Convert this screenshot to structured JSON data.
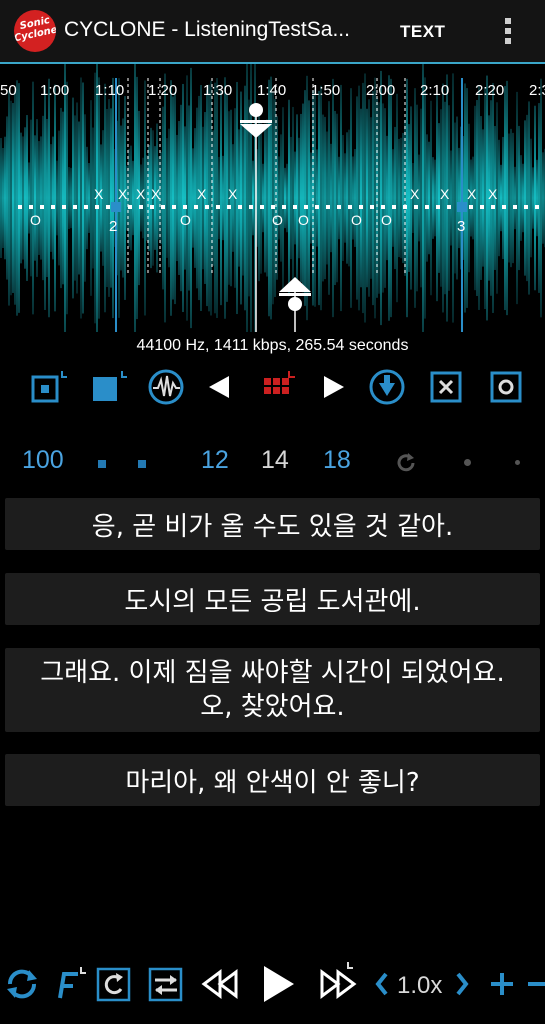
{
  "header": {
    "logo_line1": "Sonic",
    "logo_line2": "Cyclone",
    "title": "CYCLONE - ListeningTestSa...",
    "text_button": "TEXT",
    "overflow_icon": "more-vert-icon"
  },
  "timeline": {
    "ticks": [
      "50",
      "1:00",
      "1:10",
      "1:20",
      "1:30",
      "1:40",
      "1:50",
      "2:00",
      "2:10",
      "2:20",
      "2:3"
    ],
    "marker_numbers": [
      "2",
      "3"
    ]
  },
  "audio_info": "44100 Hz, 1411 kbps, 265.54 seconds",
  "controls": {
    "icons": [
      "loop-start-icon",
      "loop-end-icon",
      "waveform-icon",
      "prev-icon",
      "grid-icon",
      "next-icon",
      "download-icon",
      "clear-icon",
      "record-icon"
    ]
  },
  "marker_row": {
    "left_value": "100",
    "values": [
      "12",
      "14",
      "18"
    ]
  },
  "subtitles": [
    "응, 곧 비가 올 수도 있을 것 같아.",
    "도시의 모든 공립 도서관에.",
    "그래요. 이제 짐을 싸야할 시간이 되었어요.",
    "오, 찾았어요.",
    "마리아, 왜 안색이 안 좋니?"
  ],
  "bottom_bar": {
    "speed": "1.0x",
    "icons": [
      "repeat-icon",
      "f-icon",
      "refresh-icon",
      "swap-icon",
      "rewind-icon",
      "play-icon",
      "fast-forward-icon",
      "speed-down-icon",
      "speed-up-icon",
      "plus-icon",
      "minus-icon"
    ]
  },
  "colors": {
    "accent": "#2a8ec9",
    "wave": "#14b8be",
    "subtitle_bg": "#1d1d1d"
  }
}
